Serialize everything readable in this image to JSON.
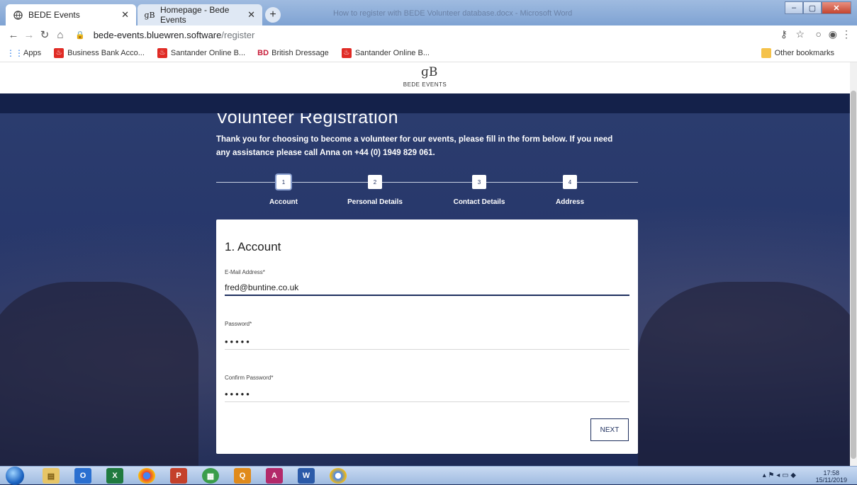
{
  "browser": {
    "tabs": [
      {
        "title": "BEDE Events",
        "favicon": "globe-icon",
        "active": true
      },
      {
        "title": "Homepage - Bede Events",
        "favicon": "bede-logo-icon",
        "active": false
      }
    ],
    "new_tab_label": "+",
    "blurred_window_title": "How to register with BEDE Volunteer database.docx - Microsoft Word",
    "url_host": "bede-events.bluewren.software",
    "url_path": "/register",
    "bookmarks": [
      {
        "label": "Apps",
        "icon": "apps-grid-icon"
      },
      {
        "label": "Business Bank Acco...",
        "icon": "santander-icon"
      },
      {
        "label": "Santander Online B...",
        "icon": "santander-icon"
      },
      {
        "label": "British Dressage",
        "icon": "bd-icon"
      },
      {
        "label": "Santander Online B...",
        "icon": "santander-icon"
      }
    ],
    "other_bookmarks": "Other bookmarks"
  },
  "site": {
    "logo_mark": "ɡB",
    "logo_text": "BEDE EVENTS"
  },
  "registration": {
    "title": "Volunteer Registration",
    "intro": "Thank you for choosing to become a volunteer for our events, please fill in the form below. If you need any assistance please call Anna on +44 (0) 1949 829 061.",
    "steps": [
      {
        "number": "1",
        "label": "Account"
      },
      {
        "number": "2",
        "label": "Personal Details"
      },
      {
        "number": "3",
        "label": "Contact Details"
      },
      {
        "number": "4",
        "label": "Address"
      }
    ],
    "active_step": 1,
    "card": {
      "title": "1. Account",
      "email_label": "E-Mail Address*",
      "email_value": "fred@buntine.co.uk",
      "password_label": "Password*",
      "password_value": "•••••",
      "confirm_label": "Confirm Password*",
      "confirm_value": "•••••",
      "next_label": "NEXT"
    }
  },
  "taskbar": {
    "time": "17:58",
    "date": "15/11/2019"
  },
  "colors": {
    "navy": "#1e2f5e",
    "banner": "#14214a"
  }
}
